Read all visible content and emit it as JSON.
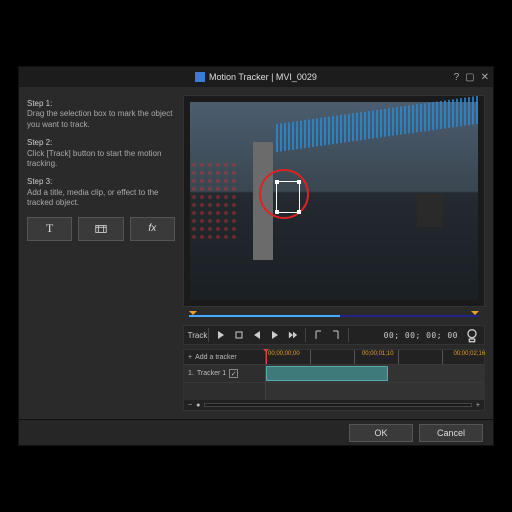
{
  "title": "Motion Tracker  |  MVI_0029",
  "steps": {
    "s1t": "Step 1:",
    "s1d": "Drag the selection box to mark the object you want to track.",
    "s2t": "Step 2:",
    "s2d": "Click [Track] button to start the motion tracking.",
    "s3t": "Step 3:",
    "s3d": "Add a title, media clip, or effect to the tracked object."
  },
  "buttons": {
    "title": "T",
    "fx": "fx"
  },
  "track_label": "Track",
  "timecode": "00; 00; 00; 00",
  "add_tracker": "Add a tracker",
  "tracker_num": "1.",
  "tracker_name": "Tracker 1",
  "ruler": {
    "t0": "00;00;00;00",
    "t1": "00;00;01;10",
    "t2": "00;00;02;16"
  },
  "footer": {
    "ok": "OK",
    "cancel": "Cancel"
  }
}
